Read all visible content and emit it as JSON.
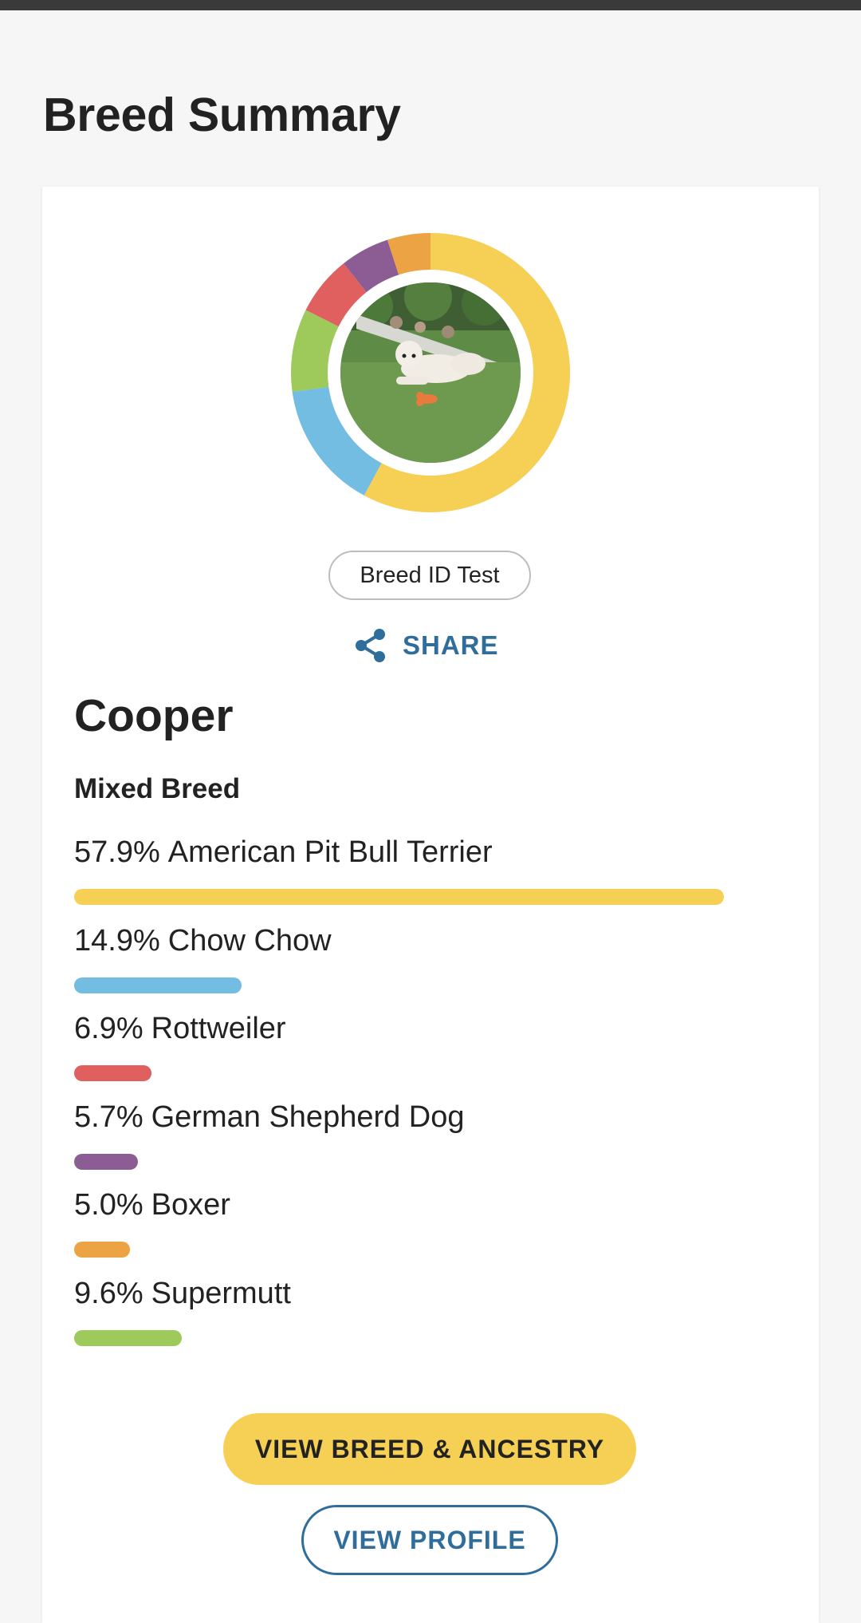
{
  "page": {
    "title": "Breed Summary"
  },
  "card": {
    "badge": "Breed ID Test",
    "share_label": "SHARE",
    "dog_name": "Cooper",
    "breed_type": "Mixed Breed",
    "breeds": [
      {
        "pct": "57.9%",
        "name": "American Pit Bull Terrier",
        "value": 57.9,
        "color": "#f6cf55"
      },
      {
        "pct": "14.9%",
        "name": "Chow Chow",
        "value": 14.9,
        "color": "#73bde3"
      },
      {
        "pct": "6.9%",
        "name": "Rottweiler",
        "value": 6.9,
        "color": "#e0605f"
      },
      {
        "pct": "5.7%",
        "name": "German Shepherd Dog",
        "value": 5.7,
        "color": "#8b5d94"
      },
      {
        "pct": "5.0%",
        "name": "Boxer",
        "value": 5.0,
        "color": "#eba344"
      },
      {
        "pct": "9.6%",
        "name": "Supermutt",
        "value": 9.6,
        "color": "#9ec95b"
      }
    ],
    "donut_order": [
      0,
      1,
      5,
      2,
      3,
      4
    ],
    "buttons": {
      "ancestry": "VIEW BREED & ANCESTRY",
      "profile": "VIEW PROFILE"
    }
  },
  "colors": {
    "accent_blue": "#2f6d9b",
    "button_yellow": "#f6cf55"
  }
}
